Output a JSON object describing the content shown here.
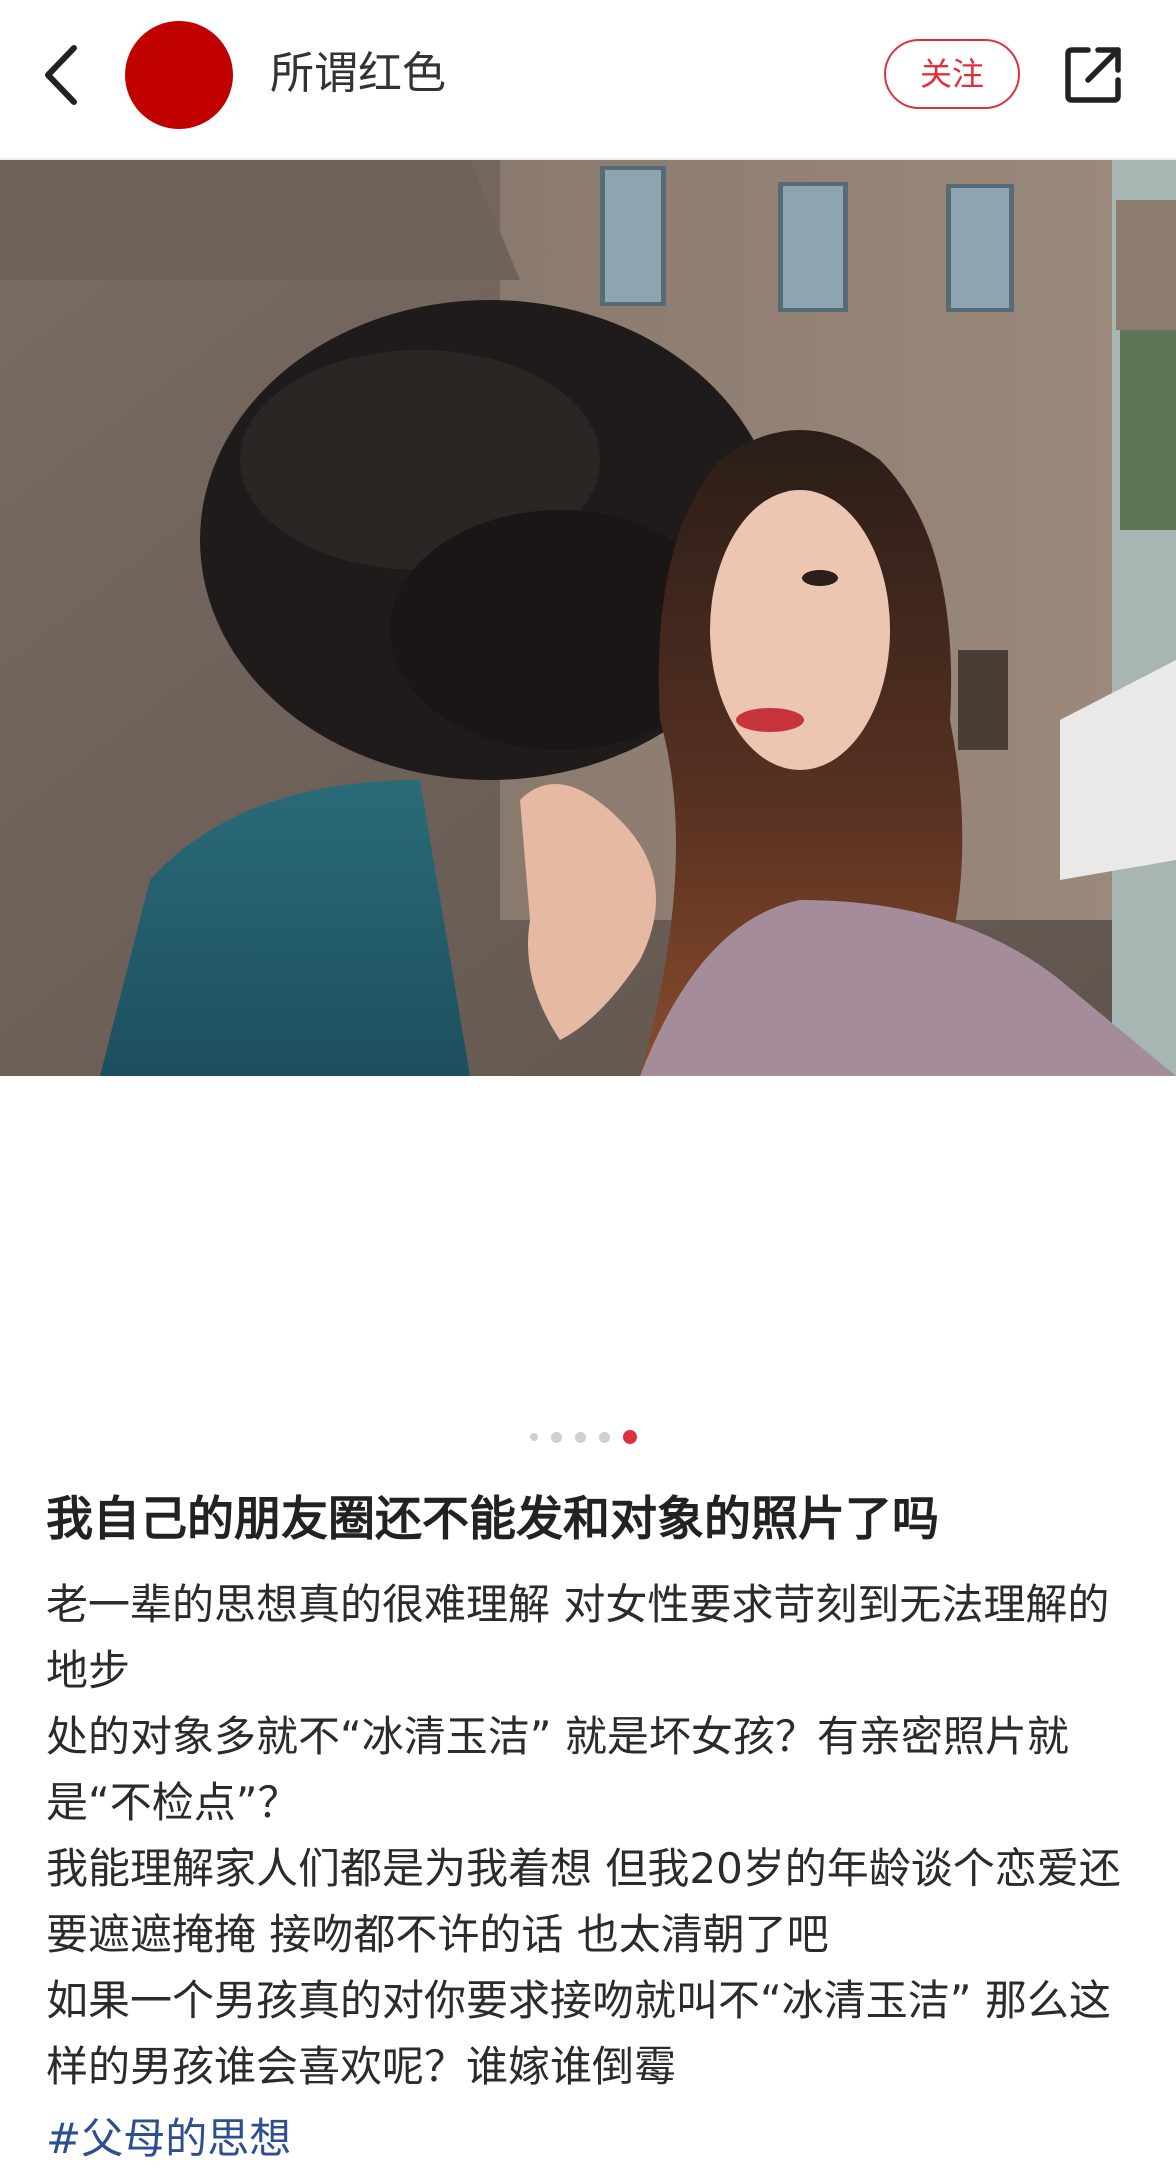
{
  "header": {
    "username": "所谓红色",
    "follow_label": "关注",
    "back_icon": "chevron-left-icon",
    "share_icon": "share-external-icon",
    "avatar_color": "#c10000"
  },
  "carousel": {
    "total": 5,
    "active_index": 4
  },
  "post": {
    "title": "我自己的朋友圈还不能发和对象的照片了吗",
    "lines": [
      "老一辈的思想真的很难理解 对女性要求苛刻到无法理解的地步",
      "处的对象多就不“冰清玉洁” 就是坏女孩？有亲密照片就是“不检点”？",
      "我能理解家人们都是为我着想 但我20岁的年龄谈个恋爱还要遮遮掩掩 接吻都不许的话 也太清朝了吧",
      "如果一个男孩真的对你要求接吻就叫不“冰清玉洁” 那么这样的男孩谁会喜欢呢？谁嫁谁倒霉"
    ],
    "hashtag": "#父母的思想"
  },
  "colors": {
    "accent": "#e0303f",
    "hashtag": "#2e4f8f",
    "dot_inactive": "#cfcfcf"
  }
}
